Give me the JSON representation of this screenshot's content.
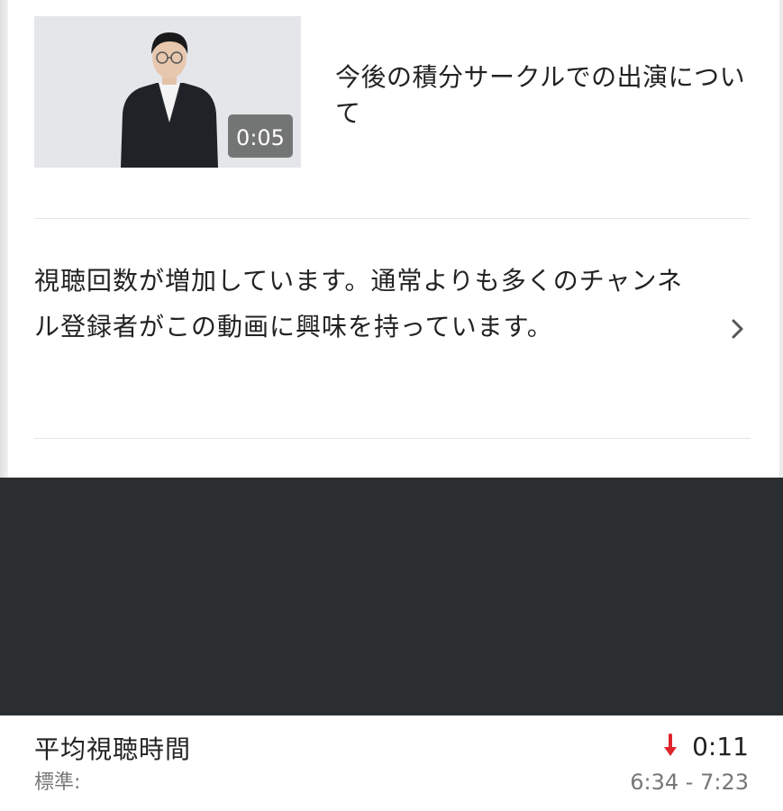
{
  "video": {
    "title": "今後の積分サークルでの出演について",
    "duration": "0:05"
  },
  "insight": {
    "text": "視聴回数が増加しています。通常よりも多くのチャンネル登録者がこの動画に興味を持っています。",
    "icon": "chevron-right-icon"
  },
  "metric": {
    "label": "平均視聴時間",
    "sublabel": "標準:",
    "trend_icon": "down-arrow-icon",
    "trend_color": "#e0242b",
    "value": "0:11",
    "range": "6:34 - 7:23"
  },
  "colors": {
    "dark_panel": "#2a2e31",
    "divider": "#e6e6e6"
  }
}
